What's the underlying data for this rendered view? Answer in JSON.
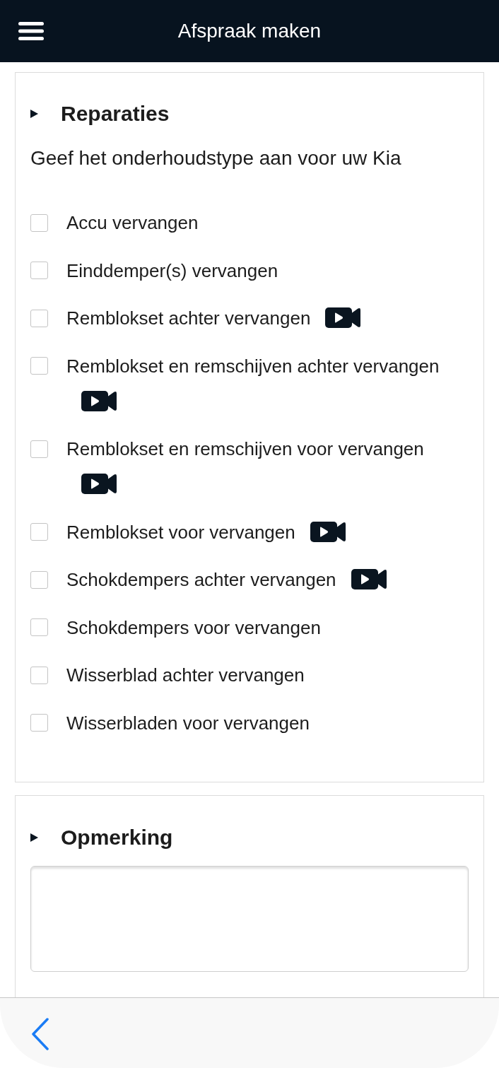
{
  "header": {
    "title": "Afspraak maken"
  },
  "sections": [
    {
      "kind": "checklist",
      "title": "Reparaties",
      "subtitle": "Geef het onderhoudstype aan voor uw Kia",
      "options": [
        {
          "label": "Accu vervangen",
          "checked": false,
          "video": false
        },
        {
          "label": "Einddemper(s) vervangen",
          "checked": false,
          "video": false
        },
        {
          "label": "Remblokset achter vervangen",
          "checked": false,
          "video": true
        },
        {
          "label": "Remblokset en remschijven achter vervangen",
          "checked": false,
          "video": true
        },
        {
          "label": "Remblokset en remschijven voor vervangen",
          "checked": false,
          "video": true
        },
        {
          "label": "Remblokset voor vervangen",
          "checked": false,
          "video": true
        },
        {
          "label": "Schokdempers achter vervangen",
          "checked": false,
          "video": true
        },
        {
          "label": "Schokdempers voor vervangen",
          "checked": false,
          "video": false
        },
        {
          "label": "Wisserblad achter vervangen",
          "checked": false,
          "video": false
        },
        {
          "label": "Wisserbladen voor vervangen",
          "checked": false,
          "video": false
        }
      ]
    },
    {
      "kind": "textarea",
      "title": "Opmerking"
    }
  ]
}
